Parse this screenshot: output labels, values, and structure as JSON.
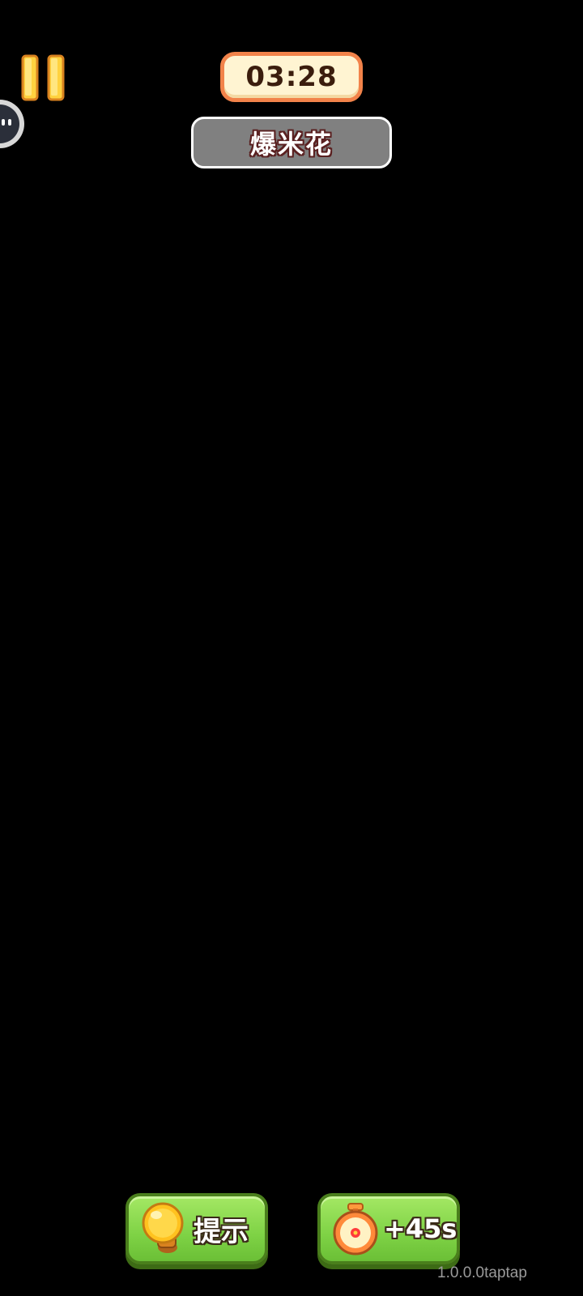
{
  "hud": {
    "timer": "03:28",
    "target_word": "爆米花"
  },
  "icons": {
    "pause": "pause-icon",
    "assistant": "floating-assistant-icon",
    "hint": "lightbulb-icon",
    "time": "stopwatch-icon"
  },
  "powerups": {
    "hint_label": "提示",
    "time_label": "+45s"
  },
  "footer": {
    "version": "1.0.0.0taptap"
  },
  "colors": {
    "background": "#000000",
    "timer_bg": "#fff4d2",
    "timer_border": "#f2834a",
    "word_bg": "#808080",
    "button_green": "#7ed245",
    "pause_yellow": "#ffd23f"
  }
}
